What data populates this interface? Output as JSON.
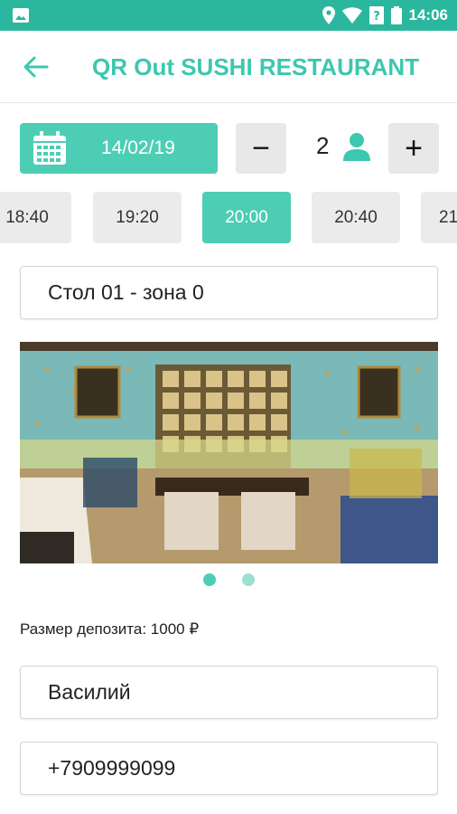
{
  "status_bar": {
    "time": "14:06",
    "icons": [
      "image-icon",
      "location-icon",
      "wifi-icon",
      "signal-unknown-icon",
      "battery-icon"
    ]
  },
  "header": {
    "title": "QR Out SUSHI RESTAURANT",
    "back_icon": "arrow-left-icon"
  },
  "booking": {
    "date": "14/02/19",
    "guests": "2",
    "minus_label": "−",
    "plus_label": "+",
    "times": [
      "18:40",
      "19:20",
      "20:00",
      "20:40",
      "21"
    ],
    "selected_time": "20:00"
  },
  "table_select": {
    "value": "Стол 01 - зона 0"
  },
  "gallery": {
    "page_count": 2,
    "current_page": 1
  },
  "deposit_text": "Размер депозита: 1000 ₽",
  "form": {
    "name_value": "Василий",
    "phone_value": "+7909999099"
  },
  "colors": {
    "accent": "#4ecdb5",
    "status_bar": "#2ab79e",
    "title": "#3cc7b0",
    "chip_bg": "#ebebeb"
  }
}
